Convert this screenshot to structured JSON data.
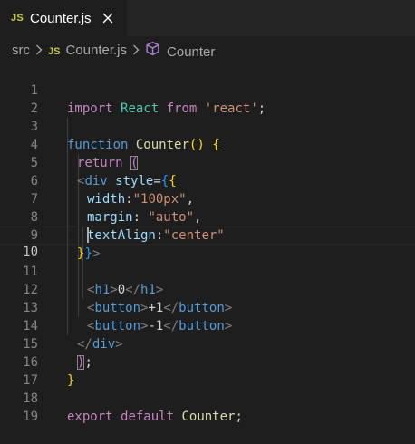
{
  "tab": {
    "icon_text": "JS",
    "file_name": "Counter.js"
  },
  "breadcrumb": {
    "folder": "src",
    "file_icon_text": "JS",
    "file": "Counter.js",
    "symbol": "Counter"
  },
  "editor": {
    "current_line": 10,
    "lines": [
      {
        "n": "1"
      },
      {
        "n": "2"
      },
      {
        "n": "3"
      },
      {
        "n": "4"
      },
      {
        "n": "5"
      },
      {
        "n": "6"
      },
      {
        "n": "7"
      },
      {
        "n": "8"
      },
      {
        "n": "9"
      },
      {
        "n": "10"
      },
      {
        "n": "11"
      },
      {
        "n": "12"
      },
      {
        "n": "13"
      },
      {
        "n": "14"
      },
      {
        "n": "15"
      },
      {
        "n": "16"
      },
      {
        "n": "17"
      },
      {
        "n": "18"
      },
      {
        "n": "19"
      }
    ],
    "code": {
      "l1": [
        "import",
        " ",
        "React",
        " ",
        "from",
        " ",
        "'react'",
        ";"
      ],
      "l3": [
        "function",
        " ",
        "Counter",
        "()",
        " ",
        "{"
      ],
      "l4": [
        "return",
        " ",
        "("
      ],
      "l5": [
        "<",
        "div",
        " ",
        "style",
        "=",
        "{",
        "{"
      ],
      "l6": [
        "width",
        ":",
        "\"100px\"",
        ","
      ],
      "l7": [
        "margin",
        ": ",
        "\"auto\"",
        ","
      ],
      "l8": [
        "textAlign",
        ":",
        "\"center\""
      ],
      "l9": [
        "}",
        "}",
        ">"
      ],
      "l11": [
        "<",
        "h1",
        ">",
        "0",
        "</",
        "h1",
        ">"
      ],
      "l12": [
        "<",
        "button",
        ">",
        "+1",
        "</",
        "button",
        ">"
      ],
      "l13": [
        "<",
        "button",
        ">",
        "-1",
        "</",
        "button",
        ">"
      ],
      "l14": [
        "</",
        "div",
        ">"
      ],
      "l15": [
        ")",
        ";"
      ],
      "l16": [
        "}"
      ],
      "l18": [
        "export",
        " ",
        "default",
        " ",
        "Counter",
        ";"
      ]
    }
  },
  "colors": {
    "background": "#1e1e1e",
    "keyword": "#c586c0",
    "function": "#dcdcaa",
    "string": "#ce9178",
    "tag": "#569cd6",
    "attribute": "#9cdcfe",
    "js_badge": "#cbcb41",
    "symbol_icon": "#b180d7"
  },
  "icons": {
    "tab_close": "close-icon",
    "breadcrumb_separator": "chevron-right-icon",
    "symbol": "symbol-cube-icon"
  }
}
